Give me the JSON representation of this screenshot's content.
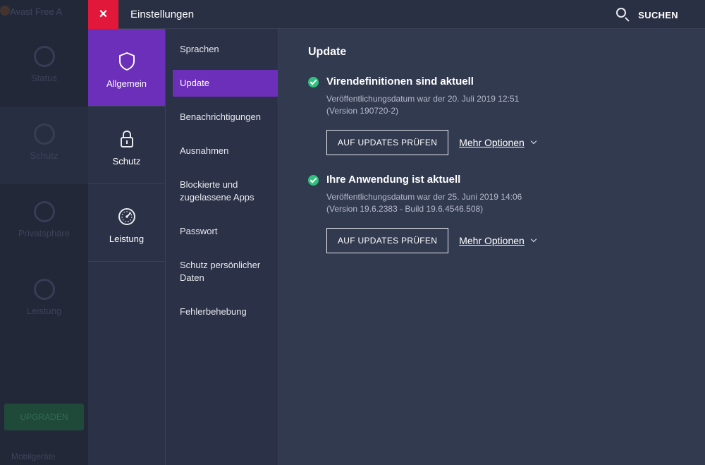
{
  "background_app": {
    "title": "Avast Free A",
    "items": [
      "Status",
      "Schutz",
      "Privatsphäre",
      "Leistung"
    ],
    "upgrade_label": "UPGRADEN",
    "bottom_label": "Mobilgeräte"
  },
  "topbar": {
    "title": "Einstellungen",
    "close_label": "×",
    "search_label": "SUCHEN"
  },
  "categories": [
    {
      "label": "Allgemein",
      "icon": "shield-icon",
      "active": true
    },
    {
      "label": "Schutz",
      "icon": "lock-icon",
      "active": false
    },
    {
      "label": "Leistung",
      "icon": "gauge-icon",
      "active": false
    }
  ],
  "submenu": [
    {
      "label": "Sprachen"
    },
    {
      "label": "Update",
      "active": true
    },
    {
      "label": "Benachrichtigungen"
    },
    {
      "label": "Ausnahmen"
    },
    {
      "label": "Blockierte und zugelassene Apps"
    },
    {
      "label": "Passwort"
    },
    {
      "label": "Schutz persönlicher Daten"
    },
    {
      "label": "Fehlerbehebung"
    }
  ],
  "content": {
    "title": "Update",
    "sections": [
      {
        "status_title": "Virendefinitionen sind aktuell",
        "line1": "Veröffentlichungsdatum war der 20. Juli 2019 12:51",
        "line2": "(Version 190720-2)",
        "button_label": "AUF UPDATES PRÜFEN",
        "more_label": "Mehr Optionen"
      },
      {
        "status_title": "Ihre Anwendung ist aktuell",
        "line1": "Veröffentlichungsdatum war der 25. Juni 2019 14:06",
        "line2": "(Version 19.6.2383 - Build 19.6.4546.508)",
        "button_label": "AUF UPDATES PRÜFEN",
        "more_label": "Mehr Optionen"
      }
    ]
  },
  "colors": {
    "accent": "#6c2fb9",
    "close": "#e1183a",
    "success": "#2ec27e",
    "background": "#2b3146",
    "content_bg": "#323a50"
  }
}
